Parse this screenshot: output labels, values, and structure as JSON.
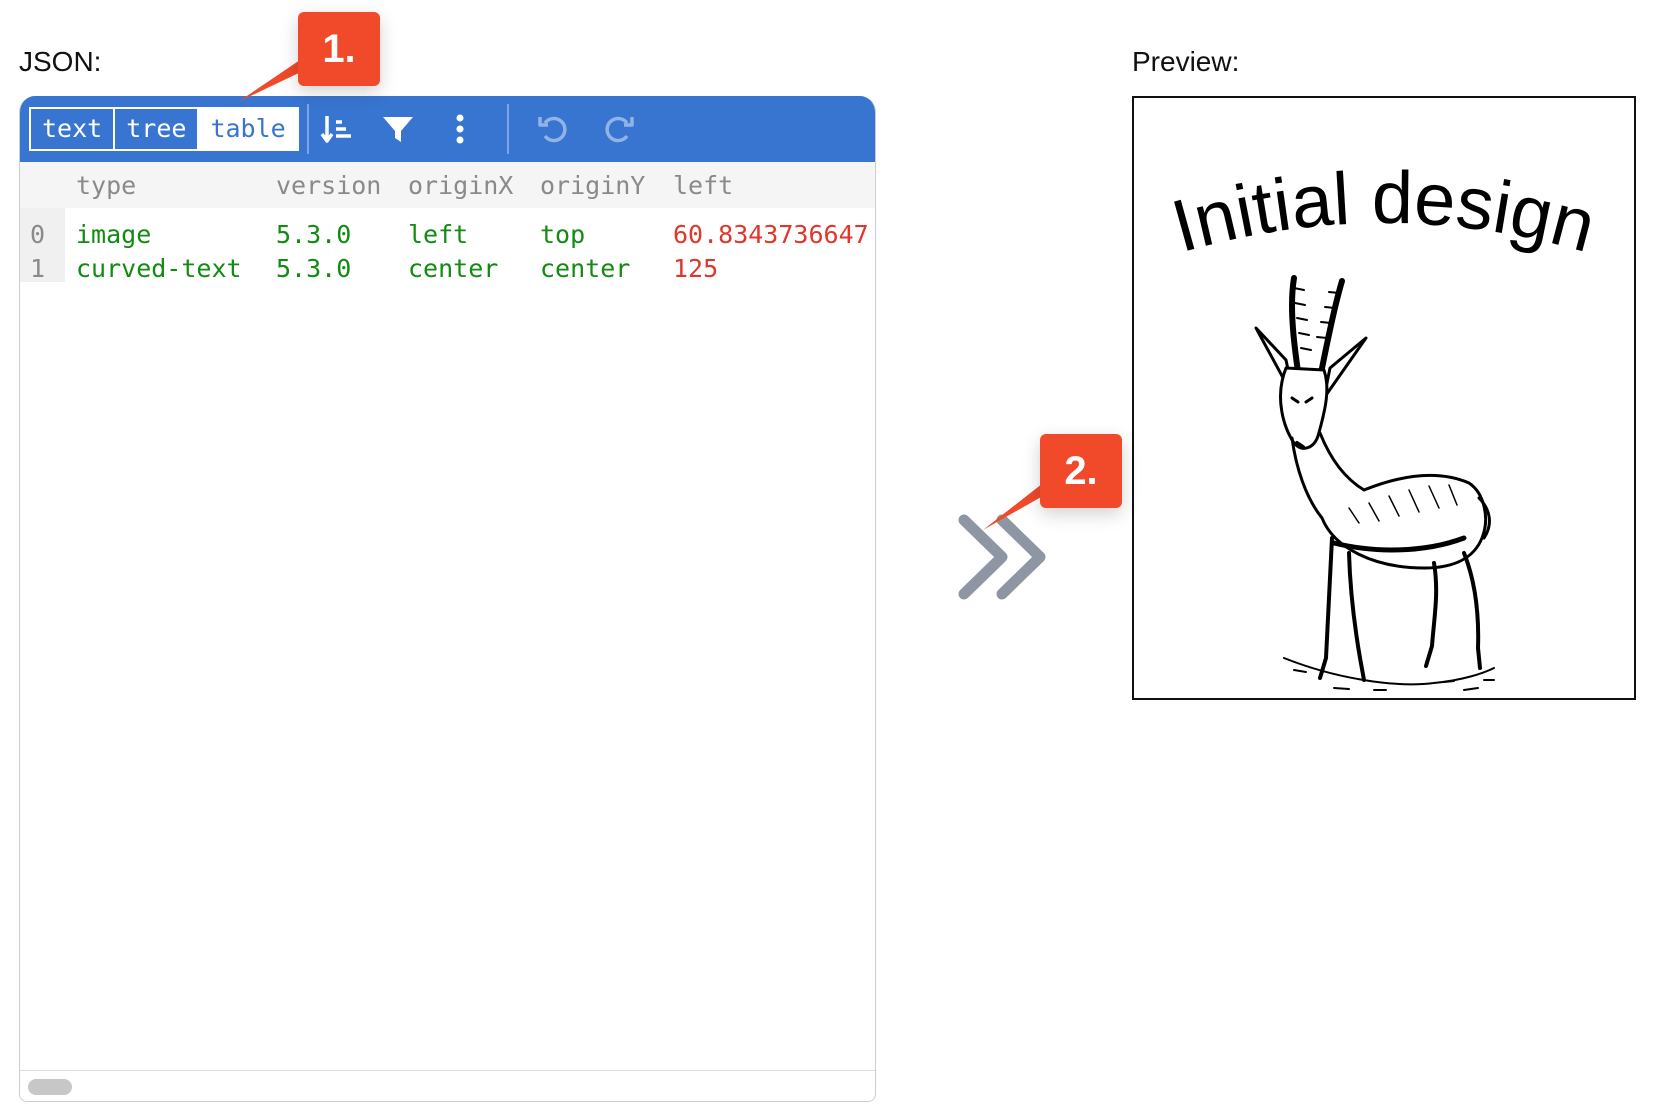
{
  "labels": {
    "json": "JSON:",
    "preview": "Preview:"
  },
  "toolbar": {
    "modes": [
      "text",
      "tree",
      "table"
    ],
    "active_mode": "table",
    "icons": [
      "sort-icon",
      "filter-icon",
      "more-options-icon",
      "undo-icon",
      "redo-icon"
    ]
  },
  "table": {
    "columns": [
      "type",
      "version",
      "originX",
      "originY",
      "left"
    ],
    "rows": [
      {
        "index": "0",
        "type": "image",
        "version": "5.3.0",
        "originX": "left",
        "originY": "top",
        "left": "60.8343736647"
      },
      {
        "index": "1",
        "type": "curved-text",
        "version": "5.3.0",
        "originX": "center",
        "originY": "center",
        "left": "125"
      }
    ]
  },
  "preview": {
    "title_text": "Initial design",
    "image_subject": "gazelle-illustration"
  },
  "callouts": {
    "one": "1.",
    "two": "2."
  },
  "colors": {
    "toolbar": "#3875d1",
    "string_value": "#138a12",
    "number_value": "#e0362b",
    "callout": "#f04a2a"
  }
}
